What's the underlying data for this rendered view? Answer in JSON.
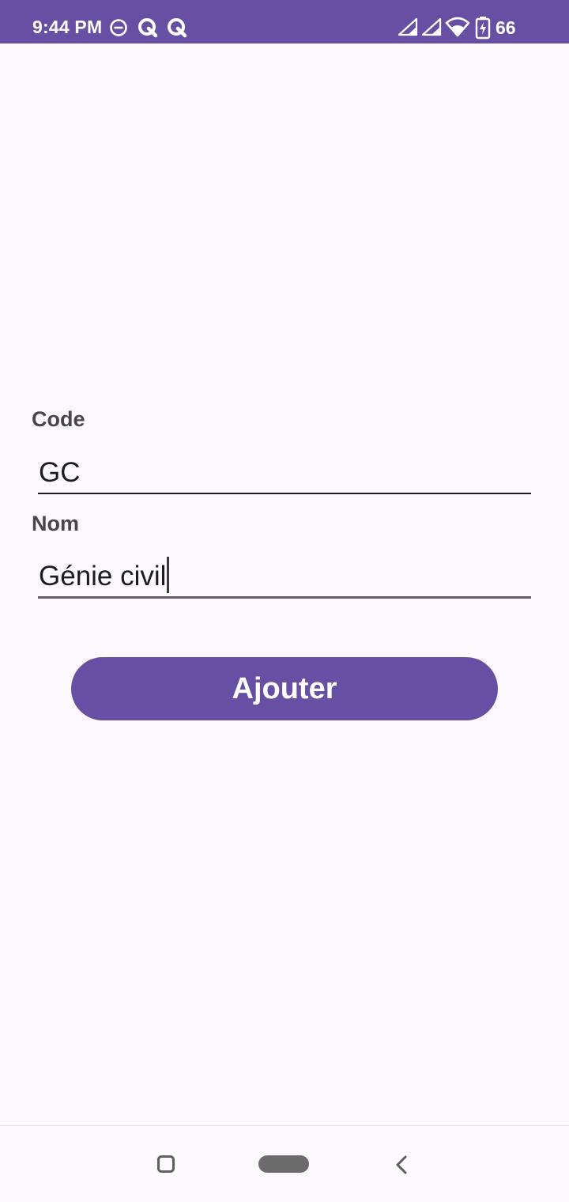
{
  "status_bar": {
    "time": "9:44 PM",
    "battery": "66",
    "icons": [
      "do-not-disturb-icon",
      "q-app-icon",
      "q-app-icon",
      "signal-icon",
      "signal-icon",
      "wifi-icon",
      "battery-charging-icon"
    ],
    "background": "#6750a4"
  },
  "form": {
    "code_label": "Code",
    "code_value": "GC",
    "nom_label": "Nom",
    "nom_value": "Génie civil"
  },
  "button": {
    "label": "Ajouter",
    "color": "#6750a4"
  },
  "nav_bar": {
    "icons": [
      "recents-square-icon",
      "home-pill-icon",
      "back-chevron-icon"
    ]
  }
}
